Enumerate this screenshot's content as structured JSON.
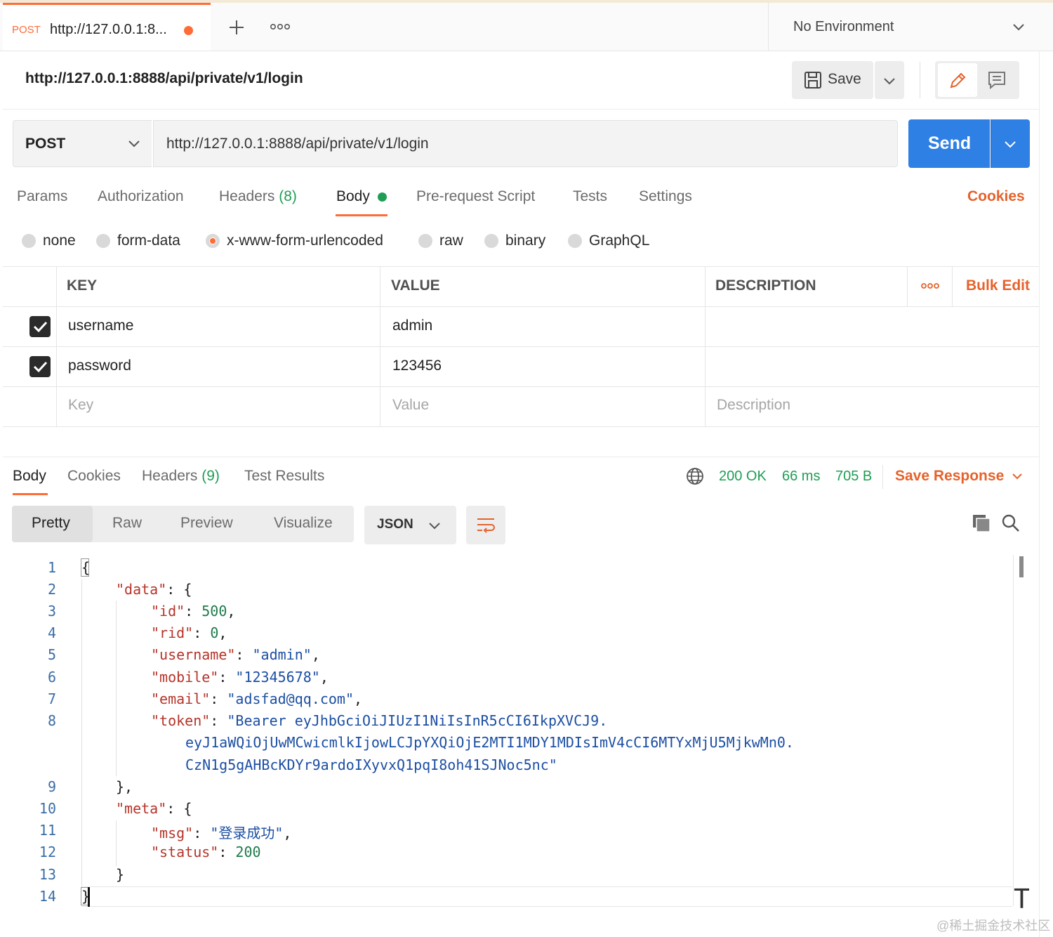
{
  "tab": {
    "method": "POST",
    "url": "http://127.0.0.1:8..."
  },
  "environment": {
    "selected": "No Environment"
  },
  "request": {
    "title": "http://127.0.0.1:8888/api/private/v1/login",
    "save_label": "Save",
    "method": "POST",
    "url": "http://127.0.0.1:8888/api/private/v1/login",
    "send_label": "Send"
  },
  "request_tabs": {
    "params": "Params",
    "authorization": "Authorization",
    "headers": "Headers",
    "headers_count": "(8)",
    "body": "Body",
    "pre_request": "Pre-request Script",
    "tests": "Tests",
    "settings": "Settings",
    "cookies": "Cookies"
  },
  "body_types": {
    "selected": "x-www-form-urlencoded",
    "options": [
      "none",
      "form-data",
      "x-www-form-urlencoded",
      "raw",
      "binary",
      "GraphQL"
    ]
  },
  "params_table": {
    "headers": {
      "key": "KEY",
      "value": "VALUE",
      "description": "DESCRIPTION",
      "bulk_edit": "Bulk Edit"
    },
    "rows": [
      {
        "checked": true,
        "key": "username",
        "value": "admin",
        "description": ""
      },
      {
        "checked": true,
        "key": "password",
        "value": "123456",
        "description": ""
      }
    ],
    "placeholders": {
      "key": "Key",
      "value": "Value",
      "description": "Description"
    }
  },
  "response": {
    "tabs": {
      "body": "Body",
      "cookies": "Cookies",
      "headers": "Headers",
      "headers_count": "(9)",
      "test_results": "Test Results"
    },
    "status": "200 OK",
    "time": "66 ms",
    "size": "705 B",
    "save_response": "Save Response",
    "views": {
      "pretty": "Pretty",
      "raw": "Raw",
      "preview": "Preview",
      "visualize": "Visualize"
    },
    "format": "JSON",
    "line_numbers": [
      "1",
      "2",
      "3",
      "4",
      "5",
      "6",
      "7",
      "8",
      "9",
      "10",
      "11",
      "12",
      "13",
      "14"
    ],
    "json": {
      "data_key": "\"data\"",
      "id_key": "\"id\"",
      "id_val": "500",
      "rid_key": "\"rid\"",
      "rid_val": "0",
      "username_key": "\"username\"",
      "username_val": "\"admin\"",
      "mobile_key": "\"mobile\"",
      "mobile_val": "\"12345678\"",
      "email_key": "\"email\"",
      "email_val": "\"adsfad@qq.com\"",
      "token_key": "\"token\"",
      "token_val_1": "\"Bearer eyJhbGciOiJIUzI1NiIsInR5cCI6IkpXVCJ9.",
      "token_val_2": "eyJ1aWQiOjUwMCwicmlkIjowLCJpYXQiOjE2MTI1MDY1MDIsImV4cCI6MTYxMjU5MjkwMn0.",
      "token_val_3": "CzN1g5gAHBcKDYr9ardoIXyvxQ1pqI8oh41SJNoc5nc\"",
      "meta_key": "\"meta\"",
      "msg_key": "\"msg\"",
      "msg_val": "\"登录成功\"",
      "status_key": "\"status\"",
      "status_val": "200"
    }
  },
  "watermark": "@稀土掘金技术社区",
  "colors": {
    "accent": "#ff6c37",
    "send": "#2f80e4",
    "success": "#1f9d55",
    "link": "#e5622c"
  }
}
